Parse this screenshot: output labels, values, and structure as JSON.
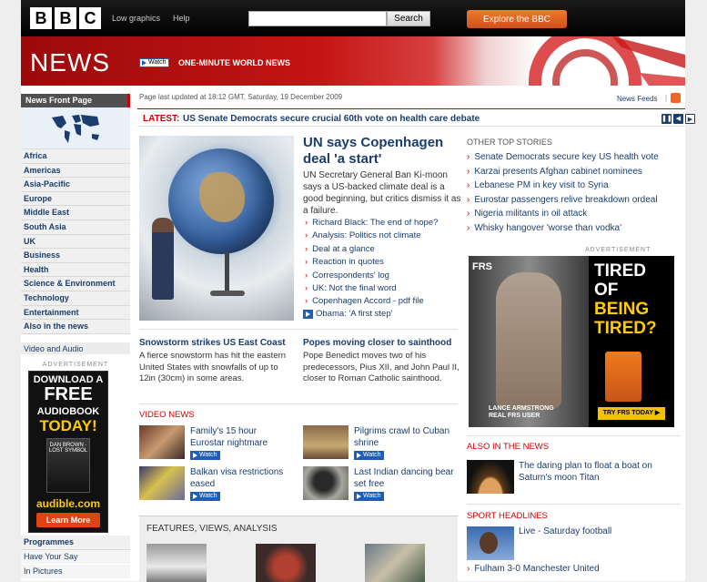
{
  "header": {
    "logo": [
      "B",
      "B",
      "C"
    ],
    "low_graphics": "Low graphics",
    "help": "Help",
    "search_button": "Search",
    "search_value": "",
    "explore": "Explore the BBC"
  },
  "banner": {
    "title": "NEWS",
    "watch": "Watch",
    "one_minute": "ONE-MINUTE WORLD NEWS"
  },
  "nav": {
    "front_page": "News Front Page",
    "items": [
      "Africa",
      "Americas",
      "Asia-Pacific",
      "Europe",
      "Middle East",
      "South Asia",
      "UK",
      "Business",
      "Health",
      "Science & Environment",
      "Technology",
      "Entertainment",
      "Also in the news"
    ],
    "video_audio": "Video and Audio",
    "bottom_items": [
      "Programmes",
      "Have Your Say",
      "In Pictures"
    ]
  },
  "left_ad": {
    "label": "ADVERTISEMENT",
    "line1": "DOWNLOAD A",
    "line2": "FREE",
    "line3": "AUDIOBOOK",
    "line4": "TODAY!",
    "book": "DAN BROWN · LOST SYMBOL",
    "brand": "audible.com",
    "cta": "Learn More"
  },
  "meta": {
    "updated": "Page last updated at 18:12 GMT, Saturday, 19 December 2009",
    "feeds": "News Feeds",
    "divider": "|"
  },
  "latest": {
    "label": "LATEST:",
    "text": "US Senate Democrats secure crucial 60th vote on health care debate"
  },
  "main_story": {
    "headline": "UN says Copenhagen deal 'a start'",
    "summary": "UN Secretary General Ban Ki-moon says a US-backed climate deal is a good beginning, but critics dismiss it as a failure.",
    "links": [
      "Richard Black: The end of hope?",
      "Analysis: Politics not climate",
      "Deal at a glance",
      "Reaction in quotes",
      "Correspondents' log",
      "UK: Not the final word",
      "Copenhagen Accord - pdf file"
    ],
    "video_link": "Obama: 'A first step'"
  },
  "sub_stories": [
    {
      "headline": "Snowstorm strikes US East Coast",
      "summary": "A fierce snowstorm has hit the eastern United States with snowfalls of up to 12in (30cm) in some areas."
    },
    {
      "headline": "Popes moving closer to sainthood",
      "summary": "Pope Benedict moves two of his predecessors, Pius XII, and John Paul II, closer to Roman Catholic sainthood."
    }
  ],
  "video_news": {
    "head": "VIDEO NEWS",
    "items": [
      {
        "title": "Family's 15 hour Eurostar nightmare",
        "watch": "Watch"
      },
      {
        "title": "Pilgrims crawl to Cuban shrine",
        "watch": "Watch"
      },
      {
        "title": "Balkan visa restrictions eased",
        "watch": "Watch"
      },
      {
        "title": "Last Indian dancing bear set free",
        "watch": "Watch"
      }
    ]
  },
  "features": {
    "head": "FEATURES, VIEWS, ANALYSIS"
  },
  "other_top": {
    "head": "OTHER TOP STORIES",
    "items": [
      "Senate Democrats secure key US health vote",
      "Karzai presents Afghan cabinet nominees",
      "Lebanese PM in key visit to Syria",
      "Eurostar passengers relive breakdown ordeal",
      "Nigeria militants in oil attack",
      "Whisky hangover 'worse than vodka'"
    ]
  },
  "right_ad": {
    "label": "ADVERTISEMENT",
    "logo": "FRS",
    "tired1": "TIRED",
    "tired2": "OF",
    "tired3": "BEING",
    "tired4": "TIRED?",
    "caption1": "LANCE ARMSTRONG",
    "caption2": "REAL FRS USER",
    "cta": "TRY FRS TODAY ▶"
  },
  "also": {
    "head": "ALSO IN THE NEWS",
    "text": "The daring plan to float a boat on Saturn's moon Titan"
  },
  "sport": {
    "head": "SPORT HEADLINES",
    "live": "Live - Saturday football",
    "items": [
      "Fulham 3-0 Manchester United"
    ]
  },
  "colors": {
    "accent_red": "#c00000",
    "link_blue": "#1a3d6d",
    "explore_orange": "#e2601f"
  }
}
